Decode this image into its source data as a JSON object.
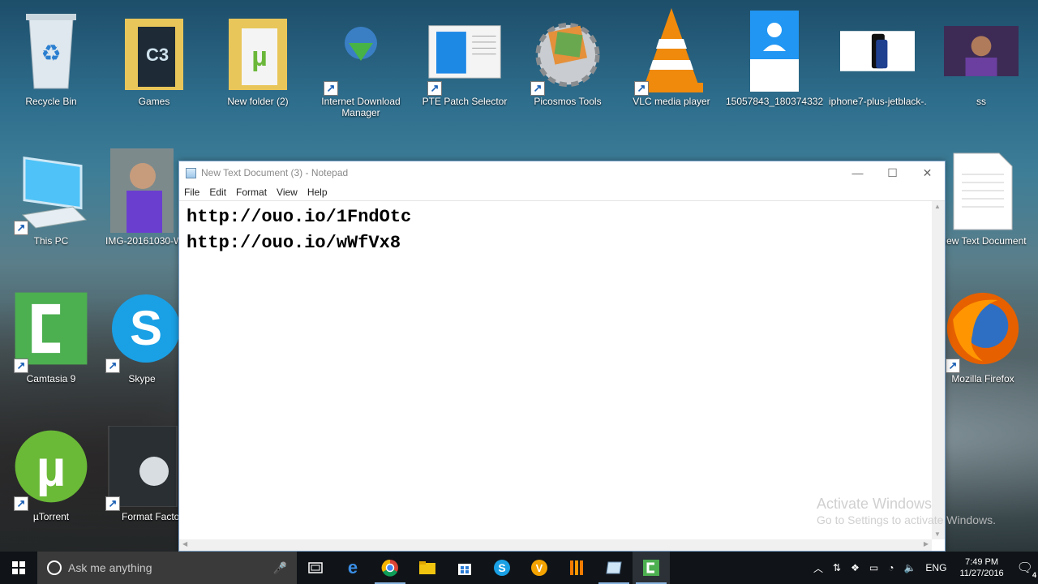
{
  "desktop": {
    "icons_row1": [
      {
        "label": "Recycle Bin",
        "icon": "recycle-bin-icon"
      },
      {
        "label": "Games",
        "icon": "folder-icon"
      },
      {
        "label": "New folder (2)",
        "icon": "folder-icon"
      },
      {
        "label": "Internet Download Manager",
        "label2": "Manager",
        "label1": "Internet Download",
        "icon": "idm-icon"
      },
      {
        "label": "PTE Patch Selector",
        "icon": "window-app-icon"
      },
      {
        "label": "Picosmos Tools",
        "icon": "picosmos-gear-icon"
      },
      {
        "label": "VLC media player",
        "icon": "vlc-cone-icon"
      },
      {
        "label": "15057843_18037433298...",
        "icon": "image-thumb-icon"
      },
      {
        "label": "iphone7-plus-jetblack-...",
        "icon": "image-thumb-icon"
      },
      {
        "label": "ss",
        "icon": "image-thumb-icon"
      }
    ],
    "icons_left": [
      {
        "label": "This PC",
        "icon": "computer-icon"
      },
      {
        "label": "IMG-20161030-W",
        "icon": "photo-thumb-icon"
      },
      {
        "label": "Camtasia 9",
        "icon": "camtasia-icon"
      },
      {
        "label": "Skype",
        "icon": "skype-icon"
      },
      {
        "label": "µTorrent",
        "icon": "utorrent-icon"
      },
      {
        "label": "Format Facto",
        "icon": "format-factory-icon"
      }
    ],
    "icons_right": [
      {
        "label": "New Text Document",
        "icon": "text-document-icon"
      },
      {
        "label": "Mozilla Firefox",
        "icon": "firefox-icon"
      }
    ]
  },
  "notepad": {
    "title": "New Text Document (3) - Notepad",
    "menu": [
      "File",
      "Edit",
      "Format",
      "View",
      "Help"
    ],
    "lines": [
      "http://ouo.io/1FndOtc",
      "http://ouo.io/wWfVx8"
    ]
  },
  "watermark": {
    "line1": "Activate Windows",
    "line2": "Go to Settings to activate Windows."
  },
  "taskbar": {
    "search_placeholder": "Ask me anything",
    "tray_lang": "ENG",
    "time": "7:49 PM",
    "date": "11/27/2016",
    "notification_count": "4"
  }
}
